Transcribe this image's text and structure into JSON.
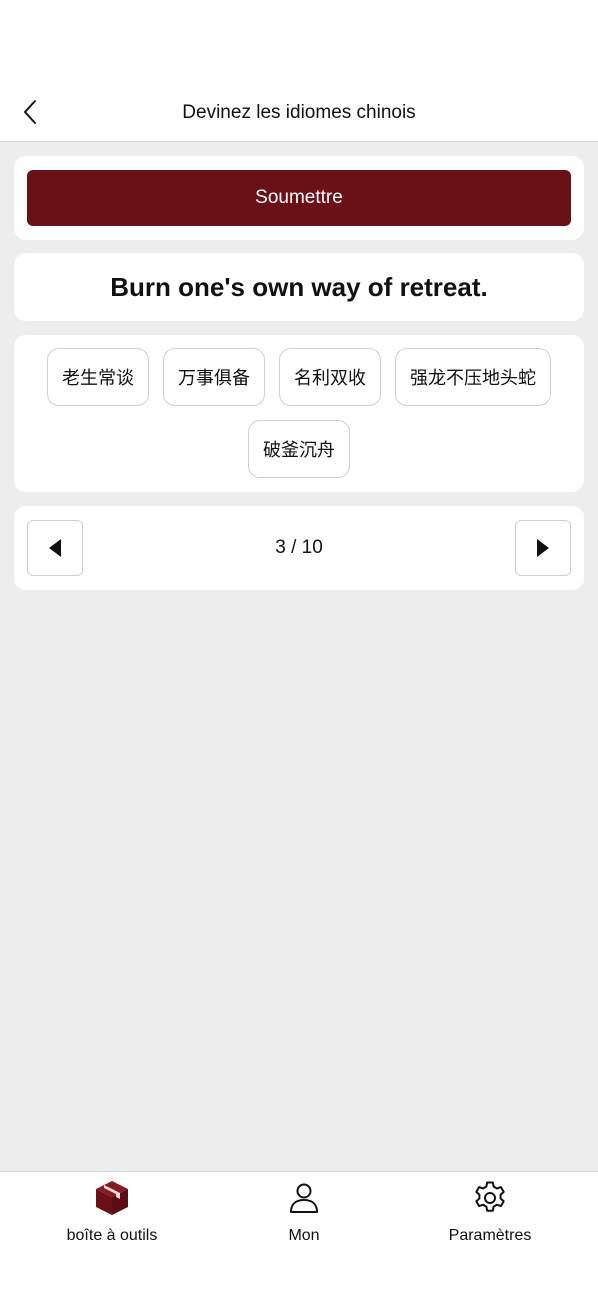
{
  "header": {
    "title": "Devinez les idiomes chinois",
    "back_icon": "chevron-left-icon"
  },
  "submit": {
    "label": "Soumettre",
    "color": "#6a1118"
  },
  "question": {
    "text": "Burn one's own way of retreat."
  },
  "options": [
    "老生常谈",
    "万事俱备",
    "名利双收",
    "强龙不压地头蛇",
    "破釜沉舟"
  ],
  "pager": {
    "counter": "3 / 10",
    "prev_icon": "triangle-left-icon",
    "next_icon": "triangle-right-icon"
  },
  "nav": {
    "accent": "#6a1118",
    "items": [
      {
        "label": "boîte à outils",
        "icon": "toolbox-icon",
        "active": true
      },
      {
        "label": "Mon",
        "icon": "user-icon",
        "active": false
      },
      {
        "label": "Paramètres",
        "icon": "gear-icon",
        "active": false
      }
    ]
  }
}
